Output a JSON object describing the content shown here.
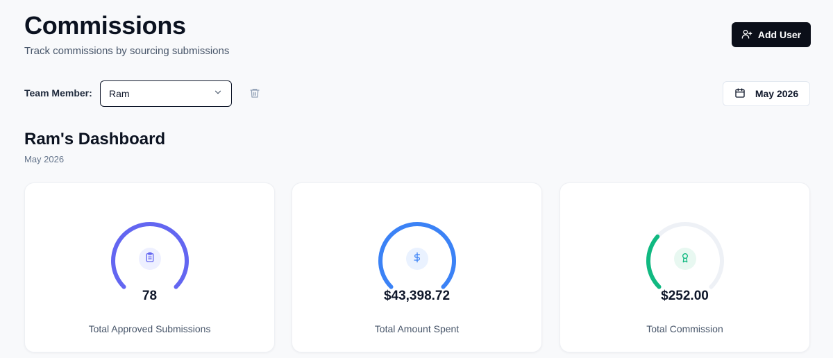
{
  "header": {
    "title": "Commissions",
    "subtitle": "Track commissions by sourcing submissions",
    "add_user_label": "Add User"
  },
  "filters": {
    "team_member_label": "Team Member:",
    "team_member_value": "Ram",
    "month_label": "May 2026"
  },
  "dashboard": {
    "title": "Ram's Dashboard",
    "period": "May 2026"
  },
  "cards": [
    {
      "value": "78",
      "label": "Total Approved Submissions",
      "progress": 1.0,
      "color": "#6366f1",
      "icon": "clipboard-icon",
      "icon_bg": "#eef0ff"
    },
    {
      "value": "$43,398.72",
      "label": "Total Amount Spent",
      "progress": 1.0,
      "color": "#3b82f6",
      "icon": "dollar-icon",
      "icon_bg": "#eaf2ff"
    },
    {
      "value": "$252.00",
      "label": "Total Commission",
      "progress": 0.32,
      "color": "#10b981",
      "icon": "award-icon",
      "icon_bg": "#e8f8f1"
    }
  ]
}
